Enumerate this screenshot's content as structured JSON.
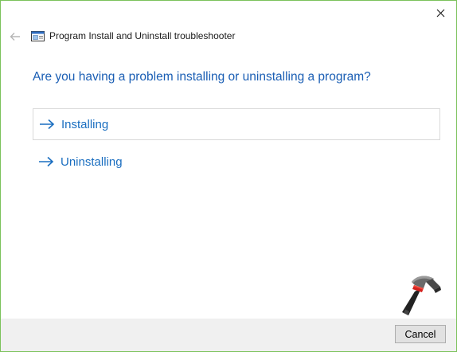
{
  "window": {
    "title": "Program Install and Uninstall troubleshooter",
    "accent_border": "#7bc25b"
  },
  "icons": {
    "close": "close-icon",
    "back": "back-arrow-icon",
    "app": "troubleshooter-icon",
    "option_arrow": "right-arrow-icon",
    "watermark": "hammer-logo-icon"
  },
  "main": {
    "question": "Are you having a problem installing or uninstalling a program?",
    "options": [
      {
        "label": "Installing"
      },
      {
        "label": "Uninstalling"
      }
    ]
  },
  "footer": {
    "cancel_label": "Cancel"
  },
  "colors": {
    "heading": "#1a5eb4",
    "link": "#1a6ec0",
    "footer_bg": "#f0f0f0"
  }
}
